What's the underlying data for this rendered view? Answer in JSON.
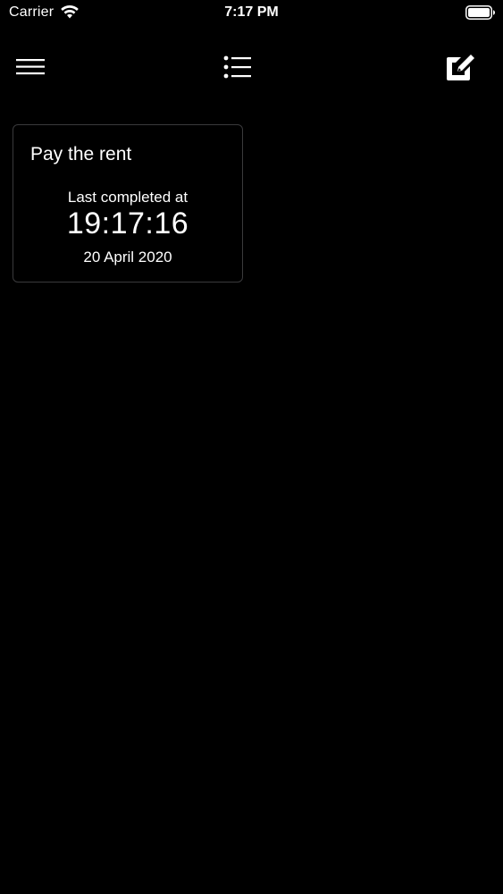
{
  "status_bar": {
    "carrier": "Carrier",
    "time": "7:17 PM",
    "wifi_icon": "wifi-icon",
    "battery_icon": "battery-icon"
  },
  "toolbar": {
    "menu_icon": "hamburger-menu-icon",
    "list_icon": "list-icon",
    "compose_icon": "compose-icon"
  },
  "tasks": [
    {
      "title": "Pay the rent",
      "completed_label": "Last completed at",
      "completed_time": "19:17:16",
      "completed_date": "20 April 2020"
    }
  ],
  "colors": {
    "background": "#000000",
    "text": "#ffffff",
    "card_border": "#3a3a3c"
  }
}
